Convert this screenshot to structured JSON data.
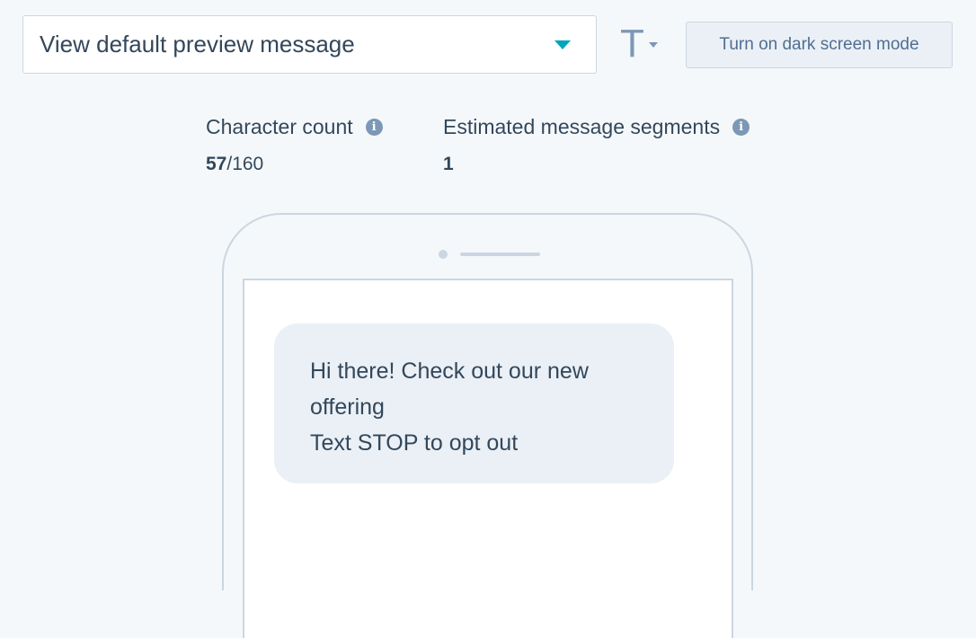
{
  "preview_select": {
    "selected": "View default preview message"
  },
  "text_size_menu": {
    "glyph": "T"
  },
  "dark_mode_button": {
    "label": "Turn on dark screen mode"
  },
  "stats": {
    "character_count": {
      "label": "Character count",
      "current": "57",
      "max": "/160"
    },
    "segments": {
      "label": "Estimated message segments",
      "value": "1"
    }
  },
  "message": {
    "lines": [
      "Hi there! Check out our new",
      "offering",
      "Text STOP to opt out"
    ]
  },
  "icons": {
    "dropdown": "caret-down-icon",
    "info": "info-icon"
  },
  "colors": {
    "accent": "#00a4bd",
    "text": "#33475b",
    "muted": "#7c98b6",
    "bubble": "#eaf0f6",
    "border": "#cbd6e2",
    "background": "#f5f8fa"
  }
}
